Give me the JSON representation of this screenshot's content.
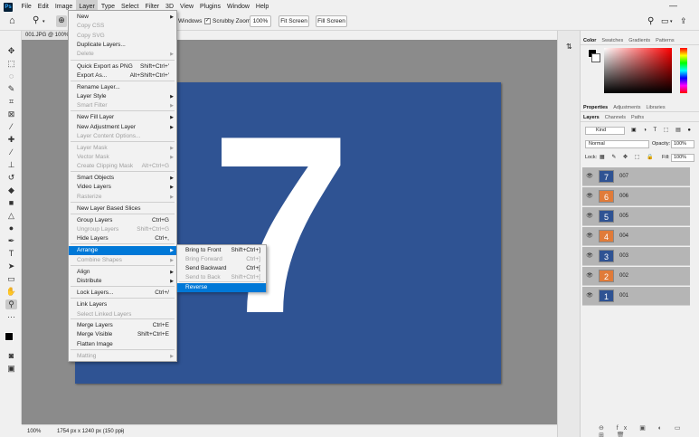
{
  "menubar": {
    "logo": "Ps",
    "items": [
      "File",
      "Edit",
      "Image",
      "Layer",
      "Type",
      "Select",
      "Filter",
      "3D",
      "View",
      "Plugins",
      "Window",
      "Help"
    ]
  },
  "options": {
    "windows_label": "Windows",
    "scrubby_label": "Scrubby Zoom",
    "zoom_value": "100%",
    "fit_screen": "Fit Screen",
    "fill_screen": "Fill Screen"
  },
  "doc_tab": "001.JPG @ 100%",
  "canvas": {
    "number": "7",
    "bg_color": "#2f5393"
  },
  "status": {
    "zoom": "100%",
    "dims": "1754 px x 1240 px (150 ppi)"
  },
  "panels": {
    "color_tabs": [
      "Color",
      "Swatches",
      "Gradients",
      "Patterns"
    ],
    "prop_tabs": [
      "Properties",
      "Adjustments",
      "Libraries"
    ],
    "layer_tabs": [
      "Layers",
      "Channels",
      "Paths"
    ],
    "kind": "Kind",
    "blend": "Normal",
    "opacity_label": "Opacity:",
    "opacity": "100%",
    "lock_label": "Lock:",
    "fill_label": "Fill:",
    "fill": "100%"
  },
  "layers": [
    {
      "num": "7",
      "name": "007",
      "color": "#2f5393"
    },
    {
      "num": "6",
      "name": "006",
      "color": "#e07b39"
    },
    {
      "num": "5",
      "name": "005",
      "color": "#2f5393"
    },
    {
      "num": "4",
      "name": "004",
      "color": "#e07b39"
    },
    {
      "num": "3",
      "name": "003",
      "color": "#2f5393"
    },
    {
      "num": "2",
      "name": "002",
      "color": "#e07b39"
    },
    {
      "num": "1",
      "name": "001",
      "color": "#2f5393"
    }
  ],
  "layer_menu": [
    {
      "label": "New",
      "sc": "",
      "arrow": true,
      "dis": false
    },
    {
      "label": "Copy CSS",
      "sc": "",
      "arrow": false,
      "dis": true
    },
    {
      "label": "Copy SVG",
      "sc": "",
      "arrow": false,
      "dis": true
    },
    {
      "label": "Duplicate Layers...",
      "sc": "",
      "arrow": false,
      "dis": false
    },
    {
      "label": "Delete",
      "sc": "",
      "arrow": true,
      "dis": true
    },
    {
      "label": "Quick Export as PNG",
      "sc": "Shift+Ctrl+'",
      "arrow": false,
      "dis": false
    },
    {
      "label": "Export As...",
      "sc": "Alt+Shift+Ctrl+'",
      "arrow": false,
      "dis": false
    },
    {
      "label": "Rename Layer...",
      "sc": "",
      "arrow": false,
      "dis": false
    },
    {
      "label": "Layer Style",
      "sc": "",
      "arrow": true,
      "dis": false
    },
    {
      "label": "Smart Filter",
      "sc": "",
      "arrow": true,
      "dis": true
    },
    {
      "label": "New Fill Layer",
      "sc": "",
      "arrow": true,
      "dis": false
    },
    {
      "label": "New Adjustment Layer",
      "sc": "",
      "arrow": true,
      "dis": false
    },
    {
      "label": "Layer Content Options...",
      "sc": "",
      "arrow": false,
      "dis": true
    },
    {
      "label": "Layer Mask",
      "sc": "",
      "arrow": true,
      "dis": true
    },
    {
      "label": "Vector Mask",
      "sc": "",
      "arrow": true,
      "dis": true
    },
    {
      "label": "Create Clipping Mask",
      "sc": "Alt+Ctrl+G",
      "arrow": false,
      "dis": true
    },
    {
      "label": "Smart Objects",
      "sc": "",
      "arrow": true,
      "dis": false
    },
    {
      "label": "Video Layers",
      "sc": "",
      "arrow": true,
      "dis": false
    },
    {
      "label": "Rasterize",
      "sc": "",
      "arrow": true,
      "dis": true
    },
    {
      "label": "New Layer Based Slices",
      "sc": "",
      "arrow": false,
      "dis": false
    },
    {
      "label": "Group Layers",
      "sc": "Ctrl+G",
      "arrow": false,
      "dis": false
    },
    {
      "label": "Ungroup Layers",
      "sc": "Shift+Ctrl+G",
      "arrow": false,
      "dis": true
    },
    {
      "label": "Hide Layers",
      "sc": "Ctrl+,",
      "arrow": false,
      "dis": false
    },
    {
      "label": "Arrange",
      "sc": "",
      "arrow": true,
      "dis": false
    },
    {
      "label": "Combine Shapes",
      "sc": "",
      "arrow": true,
      "dis": true
    },
    {
      "label": "Align",
      "sc": "",
      "arrow": true,
      "dis": false
    },
    {
      "label": "Distribute",
      "sc": "",
      "arrow": true,
      "dis": false
    },
    {
      "label": "Lock Layers...",
      "sc": "Ctrl+/",
      "arrow": false,
      "dis": false
    },
    {
      "label": "Link Layers",
      "sc": "",
      "arrow": false,
      "dis": false
    },
    {
      "label": "Select Linked Layers",
      "sc": "",
      "arrow": false,
      "dis": true
    },
    {
      "label": "Merge Layers",
      "sc": "Ctrl+E",
      "arrow": false,
      "dis": false
    },
    {
      "label": "Merge Visible",
      "sc": "Shift+Ctrl+E",
      "arrow": false,
      "dis": false
    },
    {
      "label": "Flatten Image",
      "sc": "",
      "arrow": false,
      "dis": false
    },
    {
      "label": "Matting",
      "sc": "",
      "arrow": true,
      "dis": true
    }
  ],
  "arrange_menu": [
    {
      "label": "Bring to Front",
      "sc": "Shift+Ctrl+]",
      "dis": false
    },
    {
      "label": "Bring Forward",
      "sc": "Ctrl+]",
      "dis": true
    },
    {
      "label": "Send Backward",
      "sc": "Ctrl+[",
      "dis": false
    },
    {
      "label": "Send to Back",
      "sc": "Shift+Ctrl+[",
      "dis": true
    },
    {
      "label": "Reverse",
      "sc": "",
      "dis": false
    }
  ]
}
